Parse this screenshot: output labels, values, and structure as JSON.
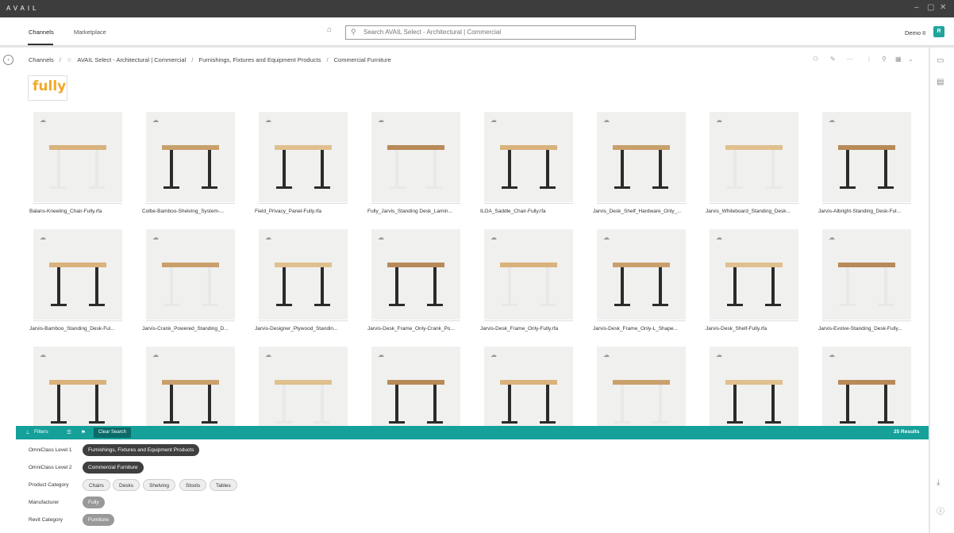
{
  "app": {
    "title": "AVAIL"
  },
  "tabs": [
    {
      "label": "Channels"
    },
    {
      "label": "Marketplace"
    }
  ],
  "search": {
    "placeholder": "Search AVAIL Select - Architectural | Commercial"
  },
  "user": {
    "name": "Demo II",
    "initial": "R"
  },
  "breadcrumb": [
    "Channels",
    "AVAIL Select - Architectural | Commercial",
    "Furnishings, Fixtures and Equipment Products",
    "Commercial Furniture"
  ],
  "breadcrumb_sep": "/",
  "channel_logo": "fully",
  "items": [
    {
      "name": "Balans-Kneeling_Chair-Fully.rfa"
    },
    {
      "name": "Colbe-Bamboo-Shelving_System-..."
    },
    {
      "name": "Field_Privacy_Panel-Fully.rfa"
    },
    {
      "name": "Fully_Jarvis_Standing Desk_Lamin..."
    },
    {
      "name": "ILOA_Saddle_Chair-Fully.rfa"
    },
    {
      "name": "Jarvis_Desk_Shelf_Hardware_Only_..."
    },
    {
      "name": "Jarvis_Whiteboard_Standing_Desk..."
    },
    {
      "name": "Jarvis-Albright-Standing_Desk-Ful..."
    },
    {
      "name": "Jarvis-Bamboo_Standing_Desk-Ful..."
    },
    {
      "name": "Jarvis-Crank_Powered_Standing_D..."
    },
    {
      "name": "Jarvis-Designer_Plywood_Standin..."
    },
    {
      "name": "Jarvis-Desk_Frame_Only-Crank_Po..."
    },
    {
      "name": "Jarvis-Desk_Frame_Only-Fully.rfa"
    },
    {
      "name": "Jarvis-Desk_Frame_Only-L_Shape..."
    },
    {
      "name": "Jarvis-Desk_Shelf-Fully.rfa"
    },
    {
      "name": "Jarvis-Evolve-Standing_Desk-Fully..."
    },
    {
      "name": ""
    },
    {
      "name": ""
    },
    {
      "name": ""
    },
    {
      "name": ""
    },
    {
      "name": ""
    },
    {
      "name": ""
    },
    {
      "name": ""
    },
    {
      "name": ""
    }
  ],
  "filterbar": {
    "filters_label": "Filters",
    "clear_label": "Clear Search",
    "results": "25 Results"
  },
  "filters": [
    {
      "label": "OmniClass Level 1",
      "chips": [
        "Furnishings, Fixtures and Equipment Products"
      ],
      "style": "dark"
    },
    {
      "label": "OmniClass Level 2",
      "chips": [
        "Commercial Furniture"
      ],
      "style": "dark"
    },
    {
      "label": "Product Category",
      "chips": [
        "Chairs",
        "Desks",
        "Shelving",
        "Stools",
        "Tables"
      ],
      "style": "light"
    },
    {
      "label": "Manufacturer",
      "chips": [
        "Fully"
      ],
      "style": "grey"
    },
    {
      "label": "Revit Category",
      "chips": [
        "Furniture"
      ],
      "style": "grey"
    }
  ],
  "colors": {
    "accent": "#15a09a",
    "titlebar": "#3d3d3d",
    "logo": "#f0a92b"
  }
}
